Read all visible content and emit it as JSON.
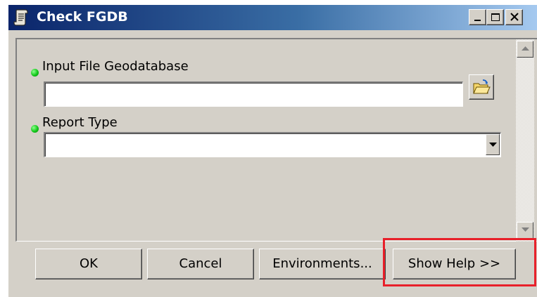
{
  "window": {
    "title": "Check FGDB",
    "title_bar_gradient": [
      "#0a246a",
      "#a6caf0"
    ],
    "app_icon": "script-scroll-icon",
    "controls": [
      "minimize-icon",
      "maximize-icon",
      "close-icon"
    ]
  },
  "parameters": [
    {
      "label": "Input File Geodatabase",
      "required": true,
      "value": "",
      "control": "text-with-browse",
      "browse_icon": "open-folder-icon"
    },
    {
      "label": "Report Type",
      "required": true,
      "value": "",
      "control": "dropdown",
      "dropdown_icon": "chevron-down-icon"
    }
  ],
  "required_indicator_color": "#12c81a",
  "buttons": {
    "ok": "OK",
    "cancel": "Cancel",
    "environments": "Environments...",
    "show_help": "Show Help >>"
  },
  "highlight_color": "#e8202a"
}
